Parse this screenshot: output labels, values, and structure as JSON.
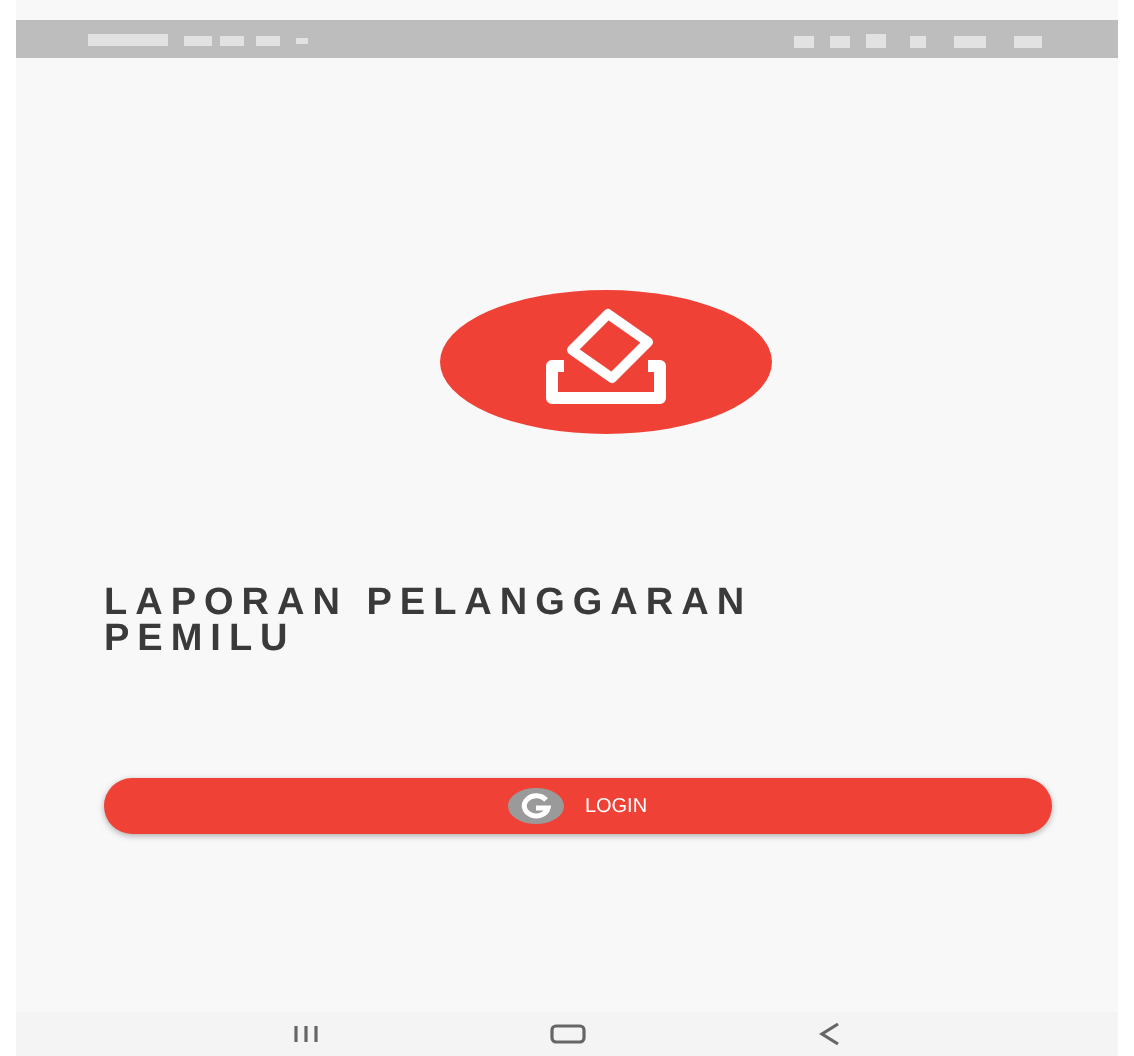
{
  "app": {
    "title": "LAPORAN PELANGGARAN PEMILU"
  },
  "login_button": {
    "label": "LOGIN"
  }
}
